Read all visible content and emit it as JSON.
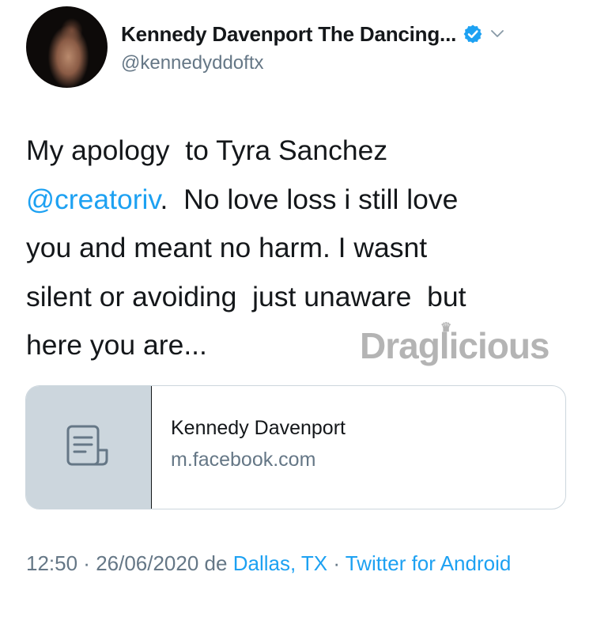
{
  "author": {
    "display_name": "Kennedy Davenport The Dancing...",
    "handle": "@kennedyddoftx",
    "verified": true
  },
  "tweet": {
    "line1": "My apology  to Tyra Sanchez",
    "mention": "@creatoriv",
    "line2_rest": ".  No love loss i still love",
    "line3": "you and meant no harm. I wasnt",
    "line4": "silent or avoiding  just unaware  but",
    "line5": "here you are..."
  },
  "watermark": "Draglicious",
  "link_card": {
    "title": "Kennedy Davenport",
    "domain": "m.facebook.com",
    "thumb_icon": "document-icon"
  },
  "meta": {
    "time": "12:50",
    "sep1": " · ",
    "date": "26/06/2020",
    "de": " de ",
    "location": "Dallas, TX",
    "sep2": " · ",
    "client": "Twitter for Android"
  },
  "colors": {
    "accent": "#1da1f2",
    "secondary_text": "#657786",
    "card_thumb_bg": "#ccd6dd"
  }
}
